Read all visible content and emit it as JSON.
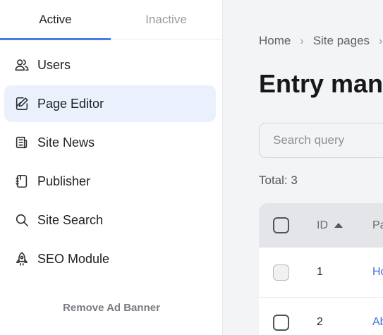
{
  "sidebar": {
    "tabs": [
      {
        "label": "Active",
        "active": true
      },
      {
        "label": "Inactive",
        "active": false
      }
    ],
    "items": [
      {
        "label": "Users",
        "icon": "users-icon"
      },
      {
        "label": "Page Editor",
        "icon": "page-edit-icon",
        "selected": true
      },
      {
        "label": "Site News",
        "icon": "news-icon"
      },
      {
        "label": "Publisher",
        "icon": "book-icon"
      },
      {
        "label": "Site Search",
        "icon": "search-icon"
      },
      {
        "label": "SEO Module",
        "icon": "rocket-icon"
      }
    ],
    "remove_ad_label": "Remove Ad Banner"
  },
  "main": {
    "breadcrumb": [
      "Home",
      "Site pages",
      ""
    ],
    "breadcrumb_separator": "›",
    "title": "Entry management",
    "search_placeholder": "Search query",
    "total_label": "Total: 3",
    "table": {
      "columns": [
        "ID",
        "Page"
      ],
      "sort": {
        "column": "ID",
        "direction": "ascending"
      },
      "rows": [
        {
          "id": "1",
          "page": "Home"
        },
        {
          "id": "2",
          "page": "About"
        }
      ]
    }
  },
  "colors": {
    "accent": "#4a7de8",
    "selected_bg": "#eaf1fd",
    "link": "#3b6fe0"
  }
}
